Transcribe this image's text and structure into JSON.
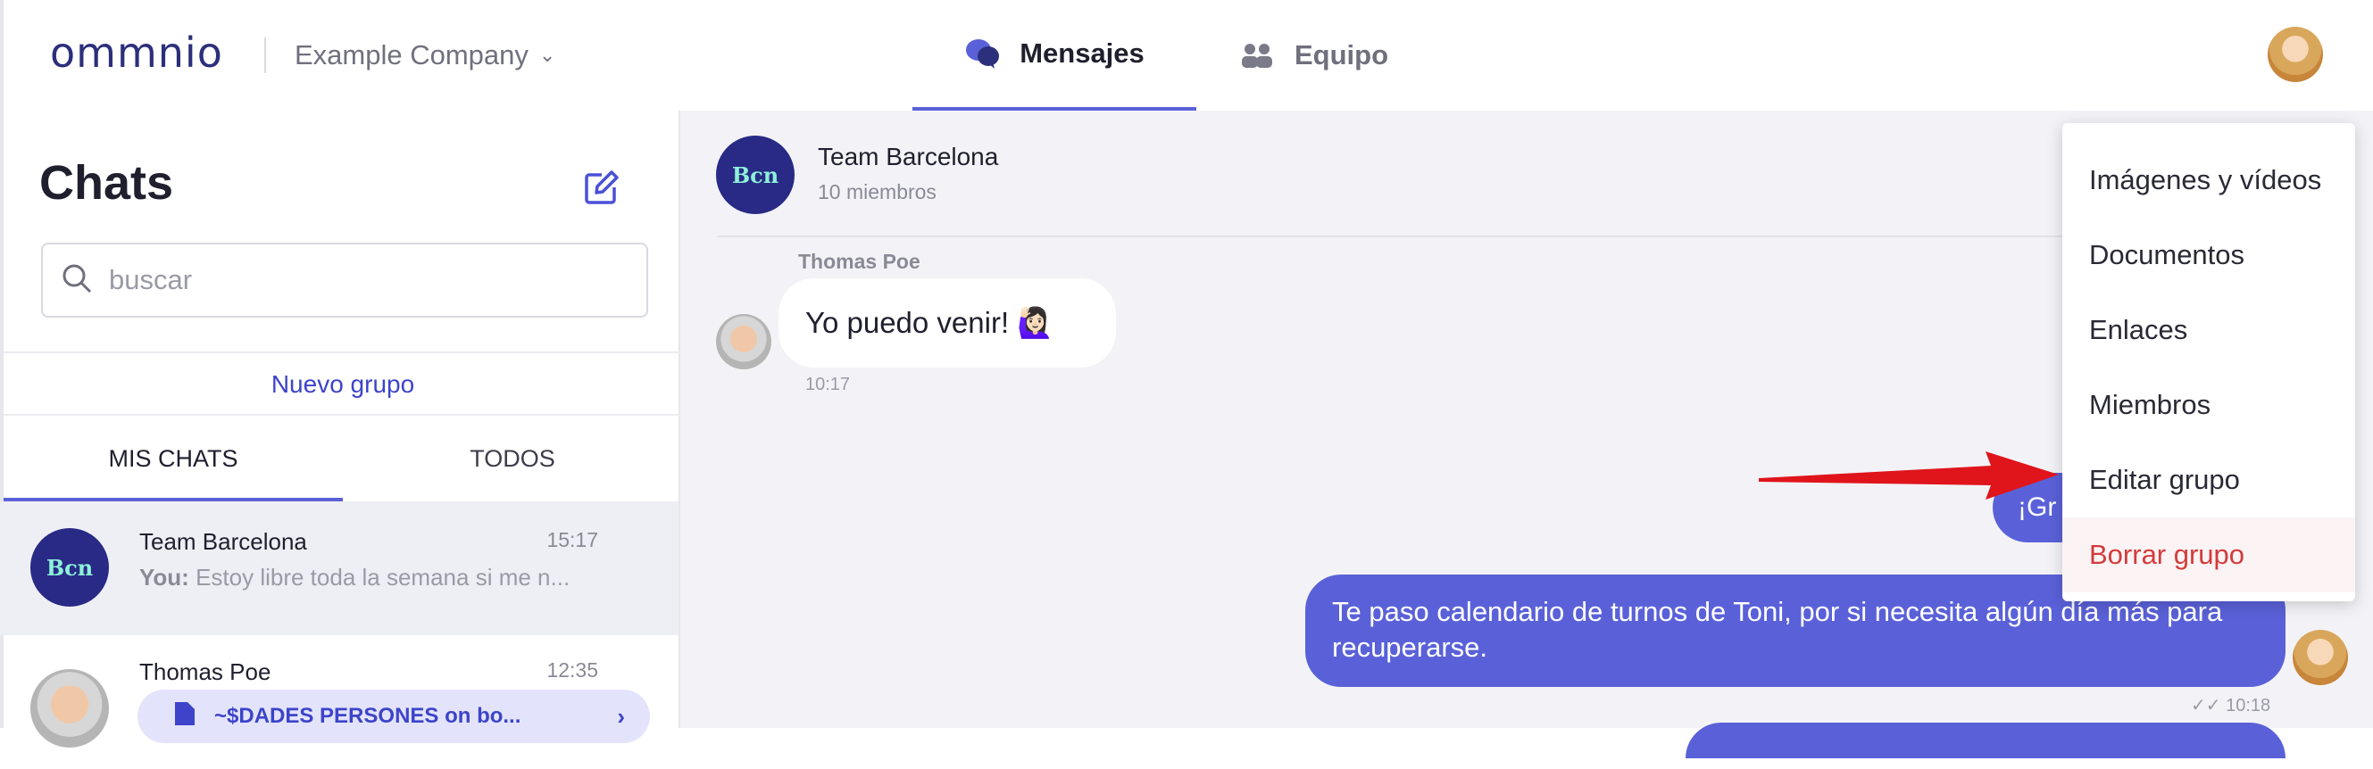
{
  "app": {
    "logo": "ommnio",
    "company": "Example Company",
    "nav": {
      "messages_label": "Mensajes",
      "team_label": "Equipo"
    }
  },
  "sidebar": {
    "title": "Chats",
    "search_placeholder": "buscar",
    "new_group_label": "Nuevo grupo",
    "tabs": [
      "MIS CHATS",
      "TODOS"
    ],
    "chats": [
      {
        "avatar_text": "Bcn",
        "name": "Team Barcelona",
        "time": "15:17",
        "preview_prefix": "You:",
        "preview": "Estoy libre toda la semana si me n..."
      },
      {
        "name": "Thomas Poe",
        "time": "12:35",
        "attachment": "~$DADES PERSONES on bo..."
      }
    ]
  },
  "chat": {
    "avatar_text": "Bcn",
    "name": "Team Barcelona",
    "members": "10 miembros",
    "messages": [
      {
        "sender": "Thomas Poe",
        "text": "Yo puedo venir! 🙋🏻‍♀️",
        "time": "10:17",
        "direction": "in"
      },
      {
        "text": "¡Gr",
        "direction": "out"
      },
      {
        "text": "Te paso calendario de turnos de Toni, por si necesita algún día más para recuperarse.",
        "time": "10:18",
        "direction": "out"
      }
    ]
  },
  "menu": {
    "items": [
      "Imágenes y vídeos",
      "Documentos",
      "Enlaces",
      "Miembros",
      "Editar grupo",
      "Borrar grupo"
    ]
  },
  "colors": {
    "accent": "#5a61d8",
    "danger": "#d33b3b",
    "annotation_arrow": "#e0141b"
  }
}
